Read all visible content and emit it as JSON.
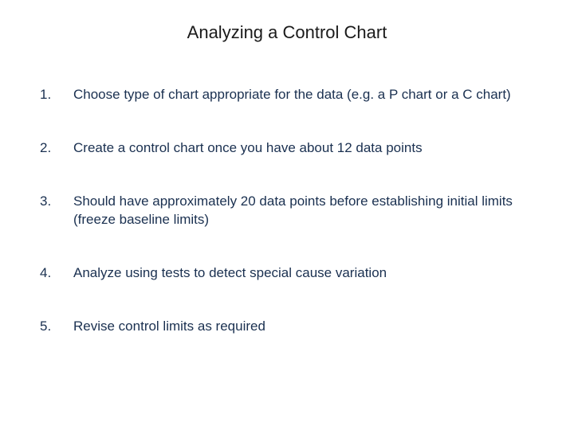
{
  "title": "Analyzing a Control Chart",
  "items": [
    {
      "marker": "1.",
      "text": "Choose type of chart appropriate for the data (e.g. a P chart or a C chart)"
    },
    {
      "marker": "2.",
      "text": "Create a control chart once you have about 12 data points"
    },
    {
      "marker": "3.",
      "text": "Should have approximately 20 data points before establishing initial limits (freeze baseline limits)"
    },
    {
      "marker": "4.",
      "text": "Analyze using tests to detect special cause variation"
    },
    {
      "marker": "5.",
      "text": "Revise control limits as required"
    }
  ]
}
